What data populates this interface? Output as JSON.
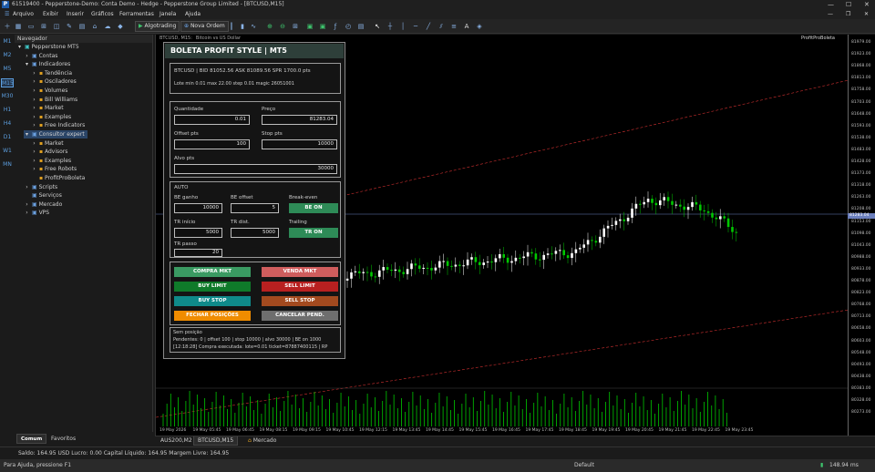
{
  "window": {
    "account": "61519400",
    "title": "61519400 - Pepperstone-Demo: Conta Demo - Hedge - Pepperstone Group Limited - [BTCUSD,M15]"
  },
  "menu": [
    "Arquivo",
    "Exibir",
    "Inserir",
    "Gráficos",
    "Ferramentas",
    "Janela",
    "Ajuda"
  ],
  "toolbar": {
    "algo": "Algotrading",
    "new_order": "Nova Ordem"
  },
  "timeframes": [
    "M1",
    "M2",
    "M5",
    "M15",
    "M30",
    "H1",
    "H4",
    "D1",
    "W1",
    "MN"
  ],
  "navigator": {
    "header": "Navegador",
    "items": [
      {
        "label": "Pepperstone MT5",
        "indent": 0,
        "glyph": "▾"
      },
      {
        "label": "Contas",
        "indent": 1,
        "glyph": "›"
      },
      {
        "label": "Indicadores",
        "indent": 1,
        "glyph": "▾"
      },
      {
        "label": "Tendência",
        "indent": 2,
        "glyph": "›"
      },
      {
        "label": "Osciladores",
        "indent": 2,
        "glyph": "›"
      },
      {
        "label": "Volumes",
        "indent": 2,
        "glyph": "›"
      },
      {
        "label": "Bill Williams",
        "indent": 2,
        "glyph": "›"
      },
      {
        "label": "Market",
        "indent": 2,
        "glyph": "›"
      },
      {
        "label": "Examples",
        "indent": 2,
        "glyph": "›"
      },
      {
        "label": "Free Indicators",
        "indent": 2,
        "glyph": "›"
      },
      {
        "label": "Consultor expert",
        "indent": 1,
        "glyph": "▾",
        "selected": true
      },
      {
        "label": "Market",
        "indent": 2,
        "glyph": "›"
      },
      {
        "label": "Advisors",
        "indent": 2,
        "glyph": "›"
      },
      {
        "label": "Examples",
        "indent": 2,
        "glyph": "›"
      },
      {
        "label": "Free Robots",
        "indent": 2,
        "glyph": "›"
      },
      {
        "label": "ProfitProBoleta",
        "indent": 2,
        "glyph": " "
      },
      {
        "label": "Scripts",
        "indent": 1,
        "glyph": "›"
      },
      {
        "label": "Serviços",
        "indent": 1,
        "glyph": " "
      },
      {
        "label": "Mercado",
        "indent": 1,
        "glyph": "›"
      },
      {
        "label": "VPS",
        "indent": 1,
        "glyph": "›"
      }
    ],
    "tabs": [
      "Comum",
      "Favoritos"
    ]
  },
  "chart": {
    "title": [
      "BTCUSD, M15:",
      "Bitcoin vs US Dollar"
    ],
    "ea_label": "ProfitProBoleta",
    "current_price": "81283.04",
    "price_labels": [
      "81979.00",
      "81923.00",
      "81868.00",
      "81813.00",
      "81758.00",
      "81703.00",
      "81648.00",
      "81593.00",
      "81538.00",
      "81483.00",
      "81428.00",
      "81373.00",
      "81318.00",
      "81263.00",
      "81208.00",
      "81153.00",
      "81098.00",
      "81043.00",
      "80988.00",
      "80933.00",
      "80878.00",
      "80823.00",
      "80768.00",
      "80713.00",
      "80658.00",
      "80603.00",
      "80548.00",
      "80493.00",
      "80438.00",
      "80383.00",
      "80328.00",
      "80273.00"
    ],
    "time_labels": [
      "19 May 2026",
      "19 May 05:45",
      "19 May 06:45",
      "19 May 08:15",
      "19 May 09:15",
      "19 May 10:45",
      "19 May 12:15",
      "19 May 13:45",
      "19 May 14:45",
      "19 May 15:45",
      "19 May 16:45",
      "19 May 17:45",
      "19 May 18:45",
      "19 May 19:45",
      "19 May 20:45",
      "19 May 21:45",
      "19 May 22:45",
      "19 May 23:45"
    ],
    "tabs": [
      "AUS200,M2",
      "BTCUSD,M15",
      "Mercado"
    ]
  },
  "panel": {
    "title": "BOLETA PROFIT STYLE | MT5",
    "info1": "BTCUSD | BID 81052.56 ASK 81089.56 SPR 1700.0 pts",
    "info2": "Lote min 0.01 max 22.00 step 0.01 magic 26051001",
    "qty_label": "Quantidade",
    "qty_value": "0.01",
    "price_label": "Preço",
    "price_value": "81283.04",
    "offset_label": "Offset pts",
    "offset_value": "100",
    "stop_label": "Stop pts",
    "stop_value": "10000",
    "alvo_label": "Alvo pts",
    "alvo_value": "30000",
    "auto_label": "AUTO",
    "be_gain_label": "BE ganho",
    "be_gain_value": "10000",
    "be_offset_label": "BE offset",
    "be_offset_value": "5",
    "be_label": "Break-even",
    "be_btn": "BE ON",
    "tr_inicio_label": "TR início",
    "tr_inicio_value": "5000",
    "tr_dist_label": "TR dist.",
    "tr_dist_value": "5000",
    "trailing_label": "Trailing",
    "tr_btn": "TR ON",
    "tr_passo_label": "TR passo",
    "tr_passo_value": "20",
    "buttons": {
      "compra": "COMPRA MKT",
      "venda": "VENDA MKT",
      "buy_limit": "BUY LIMIT",
      "sell_limit": "SELL LIMIT",
      "buy_stop": "BUY STOP",
      "sell_stop": "SELL STOP",
      "fechar": "FECHAR POSIÇÕES",
      "cancelar": "CANCELAR PEND."
    },
    "status1": "Sem posição",
    "status2": "Pendentes: 0 | offset 100 | stop 10000 | alvo 30000 | BE on 1000",
    "status3": "[12:18:28] Compra executada: lote=0.01 ticket=87887400115 | RP"
  },
  "balance": "Saldo: 164.95 USD  Lucro: 0.00  Capital Líquido: 164.95  Margem Livre: 164.95",
  "status": {
    "help": "Para Ajuda, pressione F1",
    "profile": "Default",
    "ping": "148.94 ms"
  },
  "colors": {
    "bull": "#ffffff",
    "bear": "#00c800",
    "volume": "#00c800",
    "channel": "#d03030",
    "price_line": "#6b7fbd"
  }
}
